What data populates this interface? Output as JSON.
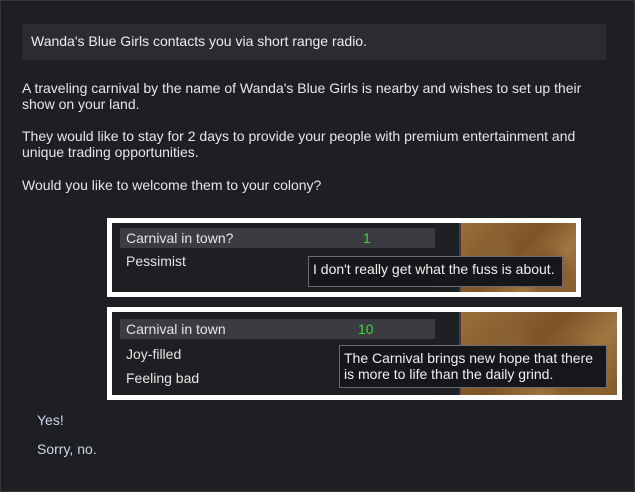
{
  "dialog": {
    "header": "Wanda's Blue Girls contacts you via short range radio.",
    "paragraphs": [
      "A traveling carnival by the name of Wanda's Blue Girls is nearby and wishes to set up their show on your land.",
      "They would like to stay for 2 days to provide your people with premium entertainment and unique trading opportunities.",
      "Would you like to welcome them to your colony?"
    ]
  },
  "mood_panel_1": {
    "title": "Carnival in town?",
    "value": "1",
    "traits": [
      "Pessimist"
    ],
    "tooltip": "I don't really get what the fuss is about."
  },
  "mood_panel_2": {
    "title": "Carnival in town",
    "value": "10",
    "traits": [
      "Joy-filled",
      "Feeling bad"
    ],
    "tooltip": "The Carnival brings new hope that there is more to life than the daily grind."
  },
  "options": [
    "Yes!",
    "Sorry, no."
  ],
  "colors": {
    "background": "#1e1f22",
    "header_bar": "#2b2c30",
    "value_green": "#3fd23f",
    "highlight_box": "#ffffff",
    "option_text": "#c9d6e6"
  }
}
